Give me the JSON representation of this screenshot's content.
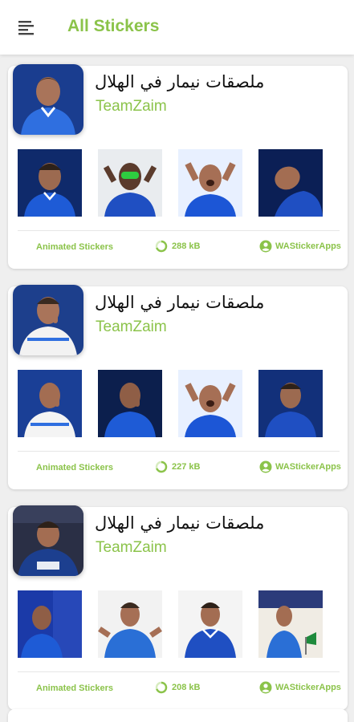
{
  "appbar": {
    "title": "All Stickers",
    "menu_icon": "menu-icon",
    "accent_color": "#8bc34a"
  },
  "packs": [
    {
      "name": "ملصقات نيمار في الهلال",
      "publisher": "TeamZaim",
      "type": "Animated Stickers",
      "size": "288 kB",
      "app": "WAStickerApps",
      "tray_palette": [
        "#1a3d8f",
        "#ffffff"
      ],
      "previews": [
        {
          "palette": [
            "#0f2a6b",
            "#1e5bd6"
          ]
        },
        {
          "palette": [
            "#f2f2f2",
            "#1f4fc2"
          ]
        },
        {
          "palette": [
            "#e8f0ff",
            "#1c56d6"
          ]
        },
        {
          "palette": [
            "#0b1f55",
            "#1f4fc2"
          ]
        }
      ]
    },
    {
      "name": "ملصقات نيمار في الهلال",
      "publisher": "TeamZaim",
      "type": "Animated Stickers",
      "size": "227 kB",
      "app": "WAStickerApps",
      "tray_palette": [
        "#1d3f8c",
        "#f2f2f2"
      ],
      "previews": [
        {
          "palette": [
            "#1a3f96",
            "#f4f4f4"
          ]
        },
        {
          "palette": [
            "#0c1f4d",
            "#1e5bd6"
          ]
        },
        {
          "palette": [
            "#e8f0ff",
            "#1c56d6"
          ]
        },
        {
          "palette": [
            "#12307a",
            "#1f4fc2"
          ]
        }
      ]
    },
    {
      "name": "ملصقات نيمار في الهلال",
      "publisher": "TeamZaim",
      "type": "Animated Stickers",
      "size": "208 kB",
      "app": "WAStickerApps",
      "tray_palette": [
        "#2a2f45",
        "#1c3f8f"
      ],
      "previews": [
        {
          "palette": [
            "#1b3aa8",
            "#1e5bd6"
          ]
        },
        {
          "palette": [
            "#f2f2f2",
            "#2a6fd6"
          ]
        },
        {
          "palette": [
            "#f4f4f4",
            "#1f4fc2"
          ]
        },
        {
          "palette": [
            "#f0ece4",
            "#2a6fd6"
          ]
        }
      ]
    }
  ]
}
